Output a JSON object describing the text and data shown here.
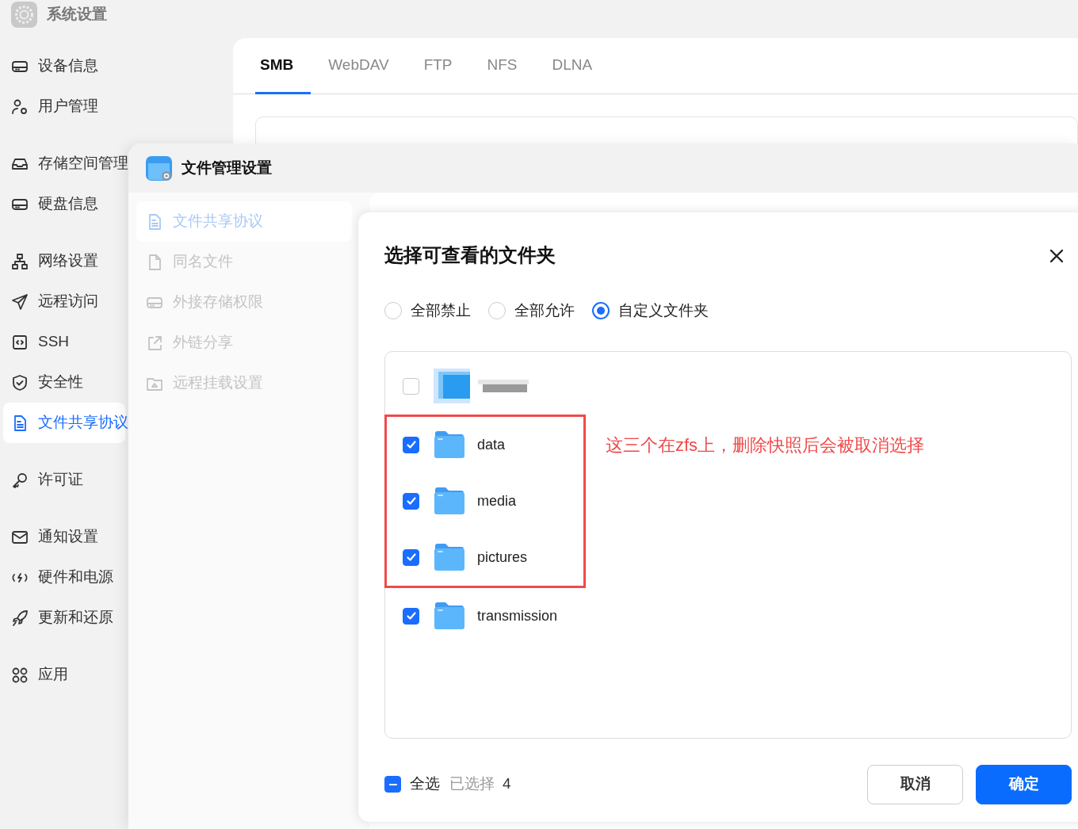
{
  "window": {
    "title": "系统设置"
  },
  "sidebar": {
    "groups": [
      [
        {
          "label": "设备信息",
          "selected": false
        },
        {
          "label": "用户管理",
          "selected": false
        }
      ],
      [
        {
          "label": "存储空间管理",
          "selected": false
        },
        {
          "label": "硬盘信息",
          "selected": false
        }
      ],
      [
        {
          "label": "网络设置",
          "selected": false
        },
        {
          "label": "远程访问",
          "selected": false
        },
        {
          "label": "SSH",
          "selected": false
        },
        {
          "label": "安全性",
          "selected": false
        },
        {
          "label": "文件共享协议",
          "selected": true
        }
      ],
      [
        {
          "label": "许可证",
          "selected": false
        }
      ],
      [
        {
          "label": "通知设置",
          "selected": false
        },
        {
          "label": "硬件和电源",
          "selected": false
        },
        {
          "label": "更新和还原",
          "selected": false
        }
      ],
      [
        {
          "label": "应用",
          "selected": false
        }
      ]
    ]
  },
  "main": {
    "tabs": [
      {
        "label": "SMB",
        "selected": true
      },
      {
        "label": "WebDAV",
        "selected": false
      },
      {
        "label": "FTP",
        "selected": false
      },
      {
        "label": "NFS",
        "selected": false
      },
      {
        "label": "DLNA",
        "selected": false
      }
    ]
  },
  "file_manager": {
    "title": "文件管理设置",
    "nav": [
      {
        "label": "文件共享协议",
        "selected": true
      },
      {
        "label": "同名文件",
        "selected": false
      },
      {
        "label": "外接存储权限",
        "selected": false
      },
      {
        "label": "外链分享",
        "selected": false
      },
      {
        "label": "远程挂载设置",
        "selected": false
      }
    ]
  },
  "dialog": {
    "title": "选择可查看的文件夹",
    "options": [
      {
        "label": "全部禁止",
        "selected": false
      },
      {
        "label": "全部允许",
        "selected": false
      },
      {
        "label": "自定义文件夹",
        "selected": true
      }
    ],
    "folders": [
      {
        "kind": "redacted",
        "checked": false,
        "highlighted": false
      },
      {
        "kind": "folder",
        "name": "data",
        "checked": true,
        "highlighted": true
      },
      {
        "kind": "folder",
        "name": "media",
        "checked": true,
        "highlighted": true
      },
      {
        "kind": "folder",
        "name": "pictures",
        "checked": true,
        "highlighted": true
      },
      {
        "kind": "folder",
        "name": "transmission",
        "checked": true,
        "highlighted": false
      }
    ],
    "annotation": "这三个在zfs上，删除快照后会被取消选择",
    "select_all": {
      "label": "全选",
      "indeterminate": true
    },
    "selected_label": "已选择",
    "selected_count": "4",
    "buttons": [
      {
        "label": "取消",
        "kind": "secondary"
      },
      {
        "label": "确定",
        "kind": "primary"
      }
    ]
  }
}
